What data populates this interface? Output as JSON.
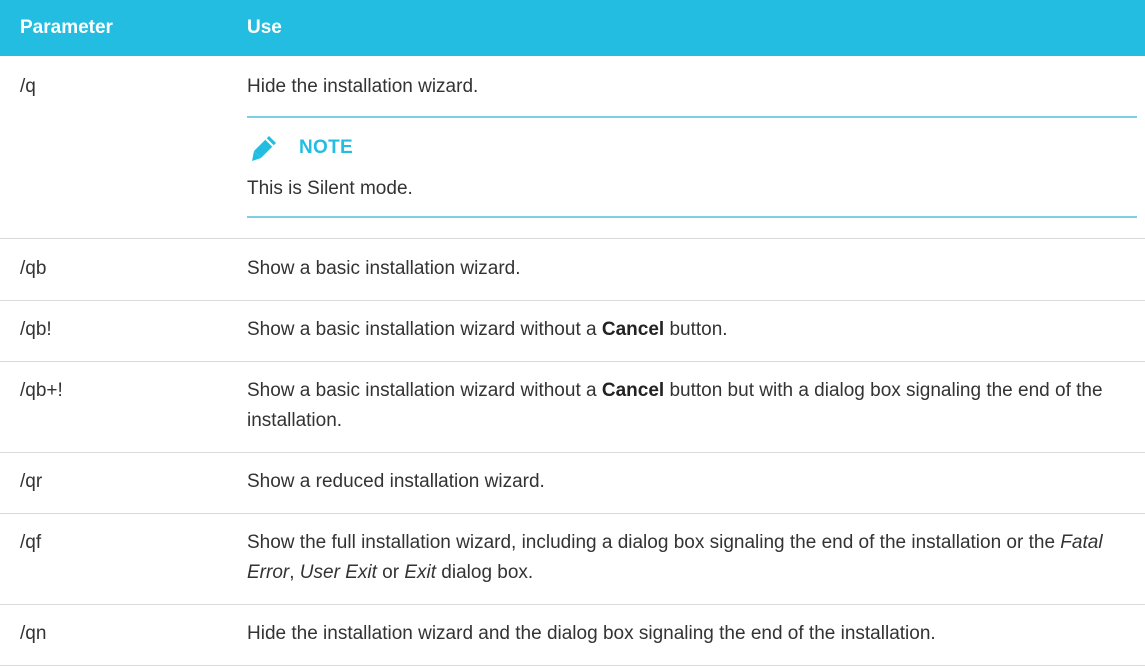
{
  "header": {
    "param": "Parameter",
    "use": "Use"
  },
  "rows": [
    {
      "param": "/q",
      "use": "Hide the installation wizard.",
      "note": {
        "title": "NOTE",
        "text": "This is Silent mode."
      }
    },
    {
      "param": "/qb",
      "use": "Show a basic installation wizard."
    },
    {
      "param": "/qb!",
      "use_a": "Show a basic installation wizard without a ",
      "use_bold": "Cancel",
      "use_b": " button."
    },
    {
      "param": "/qb+!",
      "use_a": "Show a basic installation wizard without a ",
      "use_bold": "Cancel",
      "use_b": " button but with a dialog box signaling the end of the installation."
    },
    {
      "param": "/qr",
      "use": "Show a reduced installation wizard."
    },
    {
      "param": "/qf",
      "use_a": "Show the full installation wizard, including a dialog box signaling the end of the installation or the ",
      "use_i1": "Fatal Error",
      "use_b": ", ",
      "use_i2": "User Exit",
      "use_c": " or ",
      "use_i3": "Exit",
      "use_d": " dialog box."
    },
    {
      "param": "/qn",
      "use": "Hide the installation wizard and the dialog box signaling the end of the installation."
    }
  ],
  "colors": {
    "header_bg": "#22bde0",
    "note_accent": "#22bde0",
    "note_rule": "#7dcfe6"
  },
  "icons": {
    "note": "pencil-icon"
  }
}
